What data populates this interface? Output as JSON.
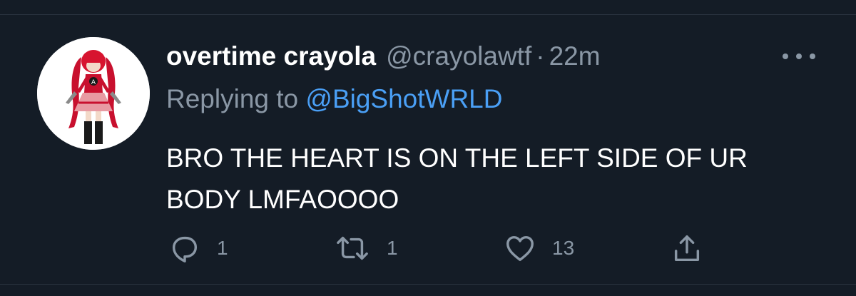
{
  "tweet": {
    "display_name": "overtime crayola",
    "handle": "@crayolawtf",
    "separator": "·",
    "time": "22m",
    "reply_prefix": "Replying to",
    "reply_to": "@BigShotWRLD",
    "text": "BRO THE HEART IS ON THE LEFT SIDE OF UR BODY LMFAOOOO"
  },
  "actions": {
    "reply": {
      "icon": "reply-icon",
      "count": "1"
    },
    "retweet": {
      "icon": "retweet-icon",
      "count": "1"
    },
    "like": {
      "icon": "heart-icon",
      "count": "13"
    },
    "share": {
      "icon": "share-icon"
    }
  },
  "more_menu": {
    "icon": "more-options-icon"
  },
  "colors": {
    "background": "#141c26",
    "primary_text": "#ffffff",
    "secondary_text": "#8a97a5",
    "link": "#4a9ff5",
    "divider": "#2b3440"
  }
}
